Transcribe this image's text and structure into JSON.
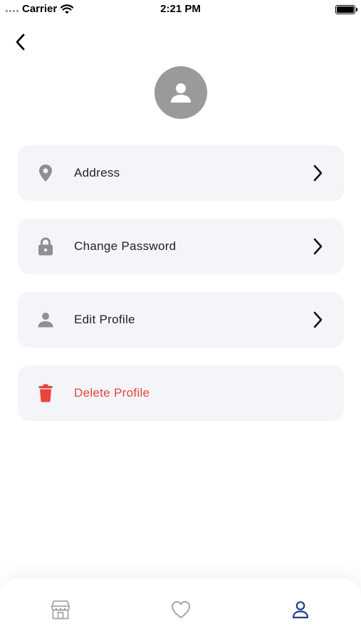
{
  "status_bar": {
    "carrier": "Carrier",
    "time": "2:21 PM"
  },
  "header": {
    "back_icon": "chevron-left-icon"
  },
  "profile": {
    "avatar_icon": "person-icon"
  },
  "menu": {
    "items": [
      {
        "label": "Address",
        "icon": "location-pin-icon"
      },
      {
        "label": "Change Password",
        "icon": "lock-icon"
      },
      {
        "label": "Edit Profile",
        "icon": "person-icon"
      },
      {
        "label": "Delete Profile",
        "icon": "trash-icon",
        "color": "#e8443a"
      }
    ]
  },
  "bottom_nav": {
    "items": [
      {
        "icon": "store-icon",
        "active": false
      },
      {
        "icon": "heart-icon",
        "active": false
      },
      {
        "icon": "user-icon",
        "active": true,
        "color": "#1f3c88"
      }
    ]
  },
  "colors": {
    "card_background": "#f3f5f8",
    "icon_gray": "#8f8f8f",
    "danger": "#e8443a",
    "accent": "#1f3c88"
  }
}
